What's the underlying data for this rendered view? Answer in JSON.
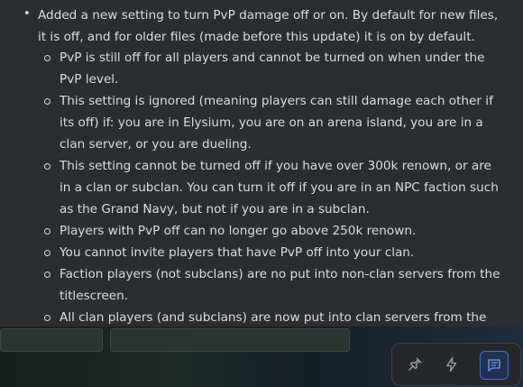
{
  "changelog": {
    "main_text": "Added a new setting to turn PvP damage off or on. By default for new files, it is off, and for older files (made before this update) it is on by default.",
    "sub_items": [
      "PvP is still off for all players and cannot be turned on when under the PvP level.",
      "This setting is ignored (meaning players can still damage each other if its off) if: you are in Elysium, you are on an arena island, you are in a clan server, or you are dueling.",
      "This setting cannot be turned off if you have over 300k renown, or are in a clan or subclan. You can turn it off if you are in an NPC faction such as the Grand Navy, but not if you are in a subclan.",
      "Players with PvP off can no longer go above 250k renown.",
      "You cannot invite players that have PvP off into your clan.",
      "Faction players (not subclans) are no put into non-clan servers from the titlescreen.",
      "All clan players (and subclans) are now put into clan servers from the"
    ]
  },
  "toolbar": {
    "buttons": [
      {
        "icon": "pin-icon",
        "active": false
      },
      {
        "icon": "lightning-icon",
        "active": false
      },
      {
        "icon": "chat-icon",
        "active": true
      }
    ],
    "accent_color": "#3e6fd8"
  }
}
